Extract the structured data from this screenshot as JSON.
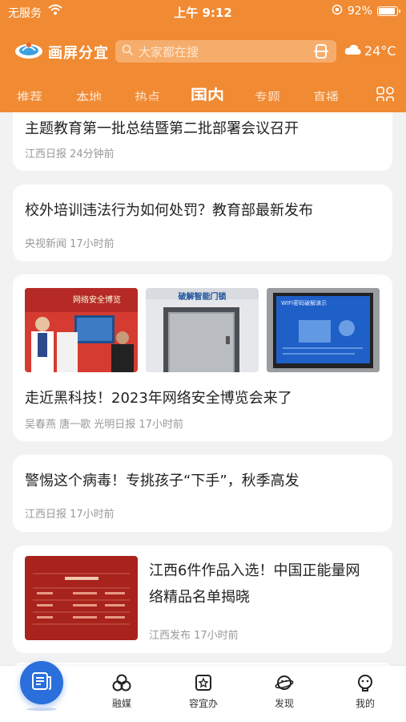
{
  "status_bar": {
    "carrier": "无服务",
    "time": "上午 9:12",
    "battery": "92%"
  },
  "header": {
    "brand": "画屏分宜",
    "search_placeholder": "大家都在搜",
    "temperature": "24°C",
    "tabs": [
      "推荐",
      "本地",
      "热点",
      "国内",
      "专题",
      "直播"
    ],
    "active_tab": "国内"
  },
  "feed": [
    {
      "title": "主题教育第一批总结暨第二批部署会议召开",
      "meta": "江西日报  24分钟前"
    },
    {
      "title": "校外培训违法行为如何处罚？教育部最新发布",
      "meta": "央视新闻  17小时前"
    },
    {
      "title": "走近黑科技！2023年网络安全博览会来了",
      "meta": "吴春燕 唐一歌 光明日报  17小时前",
      "image_texts": [
        "网络安全博览",
        "破解智能门锁",
        "WIFI密码破解演示"
      ]
    },
    {
      "title": "警惕这个病毒！专挑孩子“下手”，秋季高发",
      "meta": "江西日报  17小时前"
    },
    {
      "title_line1": "江西6件作品入选！中国正能量网",
      "title_line2": "络精品名单揭晓",
      "meta": "江西发布  17小时前"
    }
  ],
  "bottom_nav": [
    "融媒",
    "容宜办",
    "发现",
    "我的"
  ],
  "colors": {
    "brand_orange": "#f08a33",
    "nav_blue": "#2a6fdb"
  }
}
